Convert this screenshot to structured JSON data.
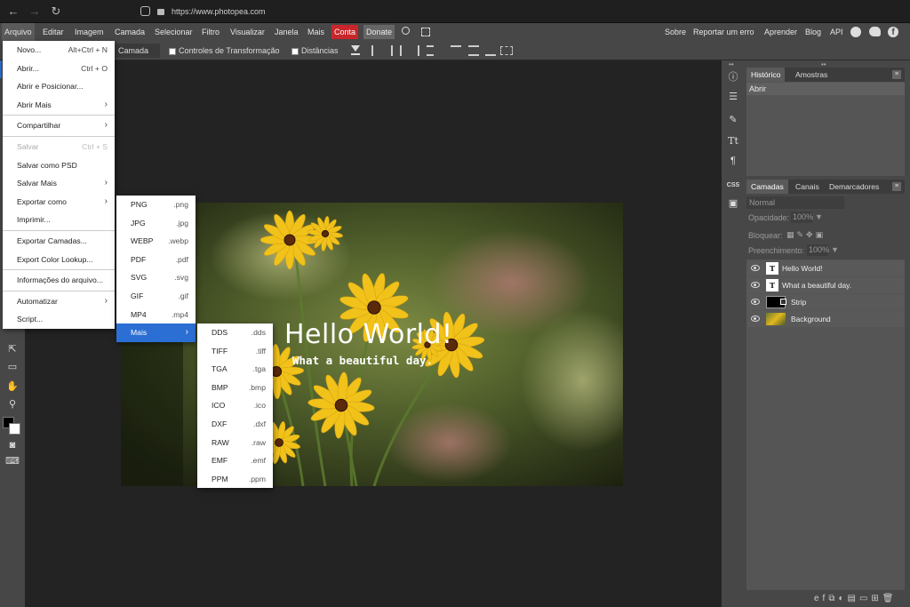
{
  "browser": {
    "url": "https://www.photopea.com"
  },
  "menubar": {
    "items": [
      "Arquivo",
      "Editar",
      "Imagem",
      "Camada",
      "Selecionar",
      "Filtro",
      "Visualizar",
      "Janela",
      "Mais"
    ],
    "conta": "Conta",
    "donate": "Donate",
    "right": [
      "Sobre",
      "Reportar um erro",
      "Aprender",
      "Blog",
      "API"
    ]
  },
  "options": {
    "select_value": "Camada",
    "transform": "Controles de Transformação",
    "distances": "Distâncias"
  },
  "file_menu": {
    "items": [
      {
        "label": "Novo...",
        "shortcut": "Alt+Ctrl + N"
      },
      {
        "label": "Abrir...",
        "shortcut": "Ctrl + O"
      },
      {
        "label": "Abrir e Posicionar..."
      },
      {
        "label": "Abrir Mais",
        "arrow": "›"
      },
      {
        "sep": true
      },
      {
        "label": "Compartilhar",
        "arrow": "›"
      },
      {
        "sep": true
      },
      {
        "label": "Salvar",
        "shortcut": "Ctrl + S",
        "disabled": true
      },
      {
        "label": "Salvar como PSD"
      },
      {
        "label": "Salvar Mais",
        "arrow": "›"
      },
      {
        "label": "Exportar como",
        "arrow": "›"
      },
      {
        "label": "Imprimir..."
      },
      {
        "sep": true
      },
      {
        "label": "Exportar Camadas..."
      },
      {
        "label": "Export Color Lookup..."
      },
      {
        "sep": true
      },
      {
        "label": "Informações do arquivo..."
      },
      {
        "sep": true
      },
      {
        "label": "Automatizar",
        "arrow": "›"
      },
      {
        "label": "Script..."
      }
    ]
  },
  "export_menu": {
    "items": [
      {
        "label": "PNG",
        "ext": ".png"
      },
      {
        "label": "JPG",
        "ext": ".jpg"
      },
      {
        "label": "WEBP",
        "ext": ".webp"
      },
      {
        "label": "PDF",
        "ext": ".pdf"
      },
      {
        "label": "SVG",
        "ext": ".svg"
      },
      {
        "label": "GIF",
        "ext": ".gif"
      },
      {
        "label": "MP4",
        "ext": ".mp4"
      },
      {
        "label": "Mais",
        "arrow": "›",
        "active": true
      }
    ]
  },
  "more_menu": {
    "items": [
      {
        "label": "DDS",
        "ext": ".dds"
      },
      {
        "label": "TIFF",
        "ext": ".tiff"
      },
      {
        "label": "TGA",
        "ext": ".tga"
      },
      {
        "label": "BMP",
        "ext": ".bmp"
      },
      {
        "label": "ICO",
        "ext": ".ico"
      },
      {
        "label": "DXF",
        "ext": ".dxf"
      },
      {
        "label": "RAW",
        "ext": ".raw"
      },
      {
        "label": "EMF",
        "ext": ".emf"
      },
      {
        "label": "PPM",
        "ext": ".ppm"
      }
    ]
  },
  "canvas": {
    "title": "Hello World!",
    "subtitle": "What a beautiful day."
  },
  "history_panel": {
    "tabs": [
      "Histórico",
      "Amostras"
    ],
    "items": [
      "Abrir"
    ]
  },
  "layers_panel": {
    "tabs": [
      "Camadas",
      "Canais",
      "Demarcadores"
    ],
    "blend": "Normal",
    "opacity_label": "Opacidade:",
    "opacity": "100%",
    "lock_label": "Bloquear:",
    "fill_label": "Preenchimento:",
    "fill": "100%",
    "layers": [
      {
        "name": "Hello World!",
        "kind": "text"
      },
      {
        "name": "What a beautiful day.",
        "kind": "text"
      },
      {
        "name": "Strip",
        "kind": "shape"
      },
      {
        "name": "Background",
        "kind": "image"
      }
    ]
  },
  "colors": {
    "accent": "#c8262a",
    "highlight": "#2b6fd4",
    "panel": "#474747"
  }
}
